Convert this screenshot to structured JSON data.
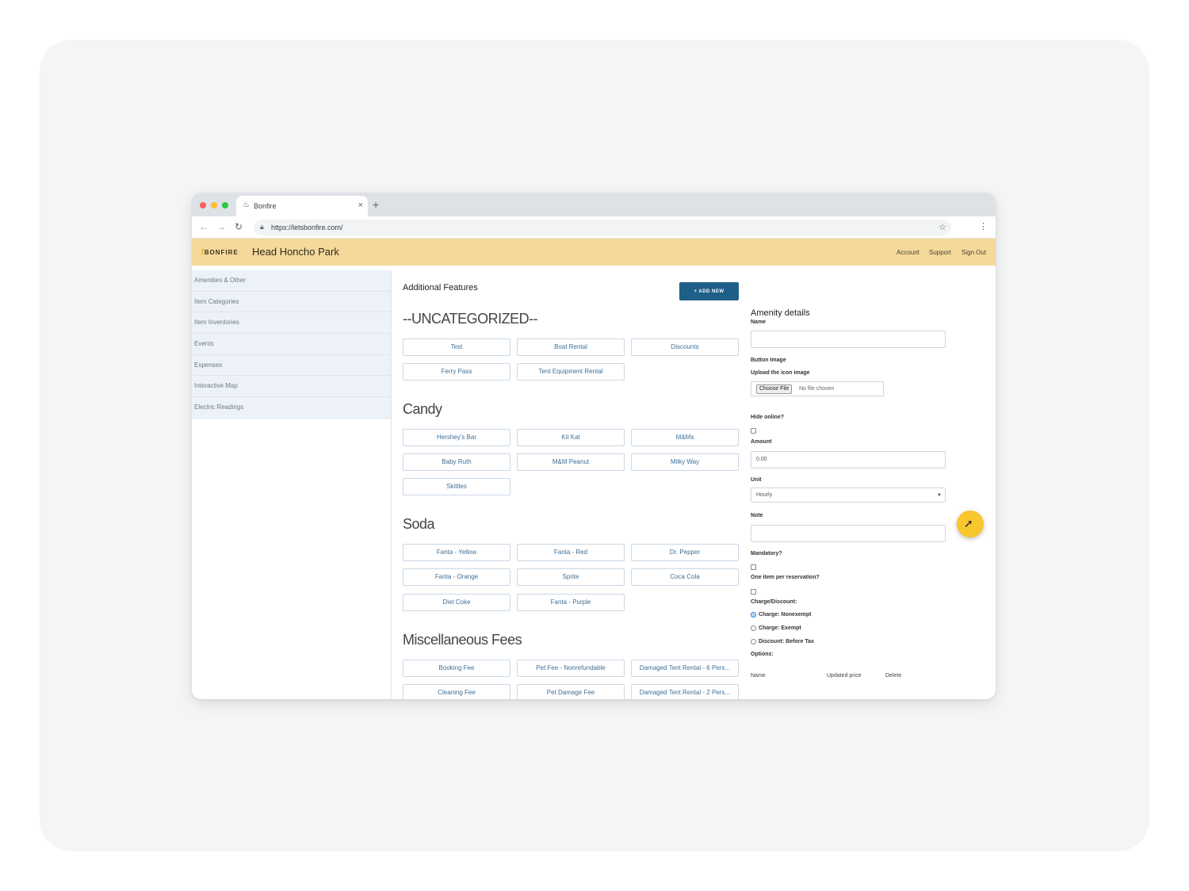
{
  "browser": {
    "tab_title": "Bonfire",
    "tab_favicon": "flame-icon",
    "url": "https://letsbonfire.com/"
  },
  "header": {
    "logo": "BONFIRE",
    "park_name": "Head Honcho Park",
    "links": [
      "Account",
      "Support",
      "Sign Out"
    ],
    "color": "#f5d99a"
  },
  "sidebar": {
    "items": [
      "Amenities & Other",
      "Item Categories",
      "Item Inventories",
      "Events",
      "Expenses",
      "Interactive Map",
      "Electric Readings"
    ]
  },
  "main": {
    "title": "Additional Features",
    "add_button": "+ ADD NEW",
    "add_button_color": "#1e5f87",
    "categories": [
      {
        "name": "--UNCATEGORIZED--",
        "items": [
          "Test",
          "Boat Rental",
          "Discounts",
          "Ferry Pass",
          "Tent Equipment Rental"
        ]
      },
      {
        "name": "Candy",
        "items": [
          "Hershey's Bar",
          "Kit Kat",
          "M&Ms",
          "Baby Ruth",
          "M&M Peanut",
          "Milky Way",
          "Skittles"
        ]
      },
      {
        "name": "Soda",
        "items": [
          "Fanta - Yellow",
          "Fanta - Red",
          "Dr. Pepper",
          "Fanta - Orange",
          "Sprite",
          "Coca Cola",
          "Diet Coke",
          "Fanta - Purple"
        ]
      },
      {
        "name": "Miscellaneous Fees",
        "items": [
          "Booking Fee",
          "Pet Fee - Nonrefundable",
          "Damaged Tent Rental - 6 Pers...",
          "Cleaning Fee",
          "Pet Damage Fee",
          "Damaged Tent Rental - 2 Pers..."
        ]
      }
    ]
  },
  "panel": {
    "title": "Amenity details",
    "name_label": "Name",
    "button_image_label": "Button Image",
    "upload_label": "Upload the icon image",
    "choose_file": "Choose File",
    "no_file": "No file chosen",
    "hide_online_label": "Hide online?",
    "amount_label": "Amount",
    "amount_value": "0.00",
    "unit_label": "Unit",
    "unit_value": "Hourly",
    "note_label": "Note",
    "mandatory_label": "Mandatory?",
    "one_item_label": "One item per reservation?",
    "charge_label": "Charge/Discount:",
    "charge_options": [
      "Charge: Nonexempt",
      "Charge: Exempt",
      "Discount: Before Tax"
    ],
    "options_label": "Options:",
    "options_columns": [
      "Name",
      "Updated price",
      "Delete"
    ]
  }
}
